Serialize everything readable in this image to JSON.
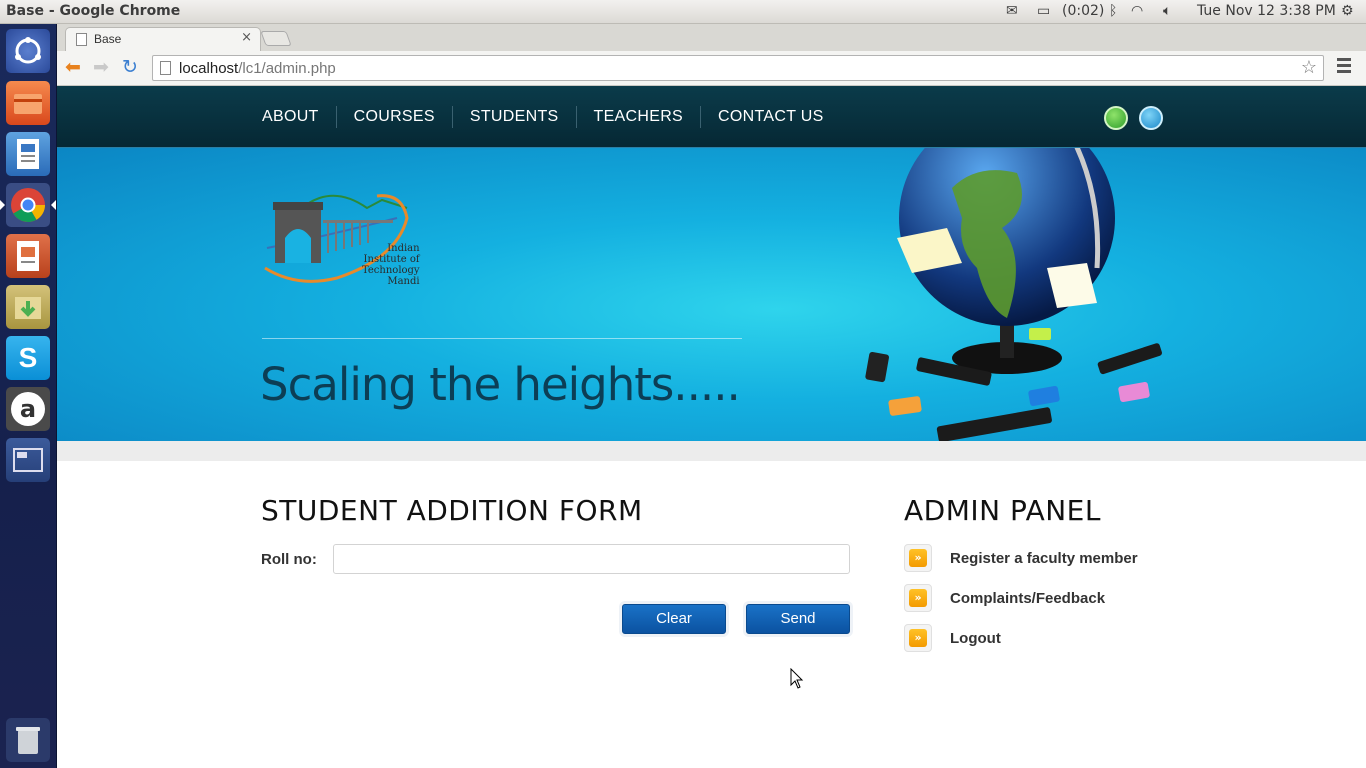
{
  "os": {
    "window_title": "Base - Google Chrome",
    "battery": "(0:02)",
    "clock": "Tue Nov 12  3:38 PM"
  },
  "browser": {
    "tab_title": "Base",
    "tab_close": "×",
    "url_host": "localhost",
    "url_path": "/lc1/admin.php"
  },
  "site": {
    "nav": [
      "ABOUT",
      "COURSES",
      "STUDENTS",
      "TEACHERS",
      "CONTACT US"
    ],
    "logo_text": [
      "Indian",
      "Institute of",
      "Technology",
      "Mandi"
    ],
    "tagline": "Scaling the heights.....",
    "form": {
      "title": "STUDENT ADDITION FORM",
      "roll_label": "Roll no:",
      "roll_value": "",
      "clear_label": "Clear",
      "send_label": "Send"
    },
    "admin": {
      "title": "ADMIN PANEL",
      "links": [
        "Register a faculty member",
        "Complaints/Feedback",
        "Logout"
      ]
    }
  },
  "colors": {
    "navbar": "#062834",
    "banner": "#14b0e0",
    "button": "#0b52a1",
    "bullet": "#f39a00"
  }
}
